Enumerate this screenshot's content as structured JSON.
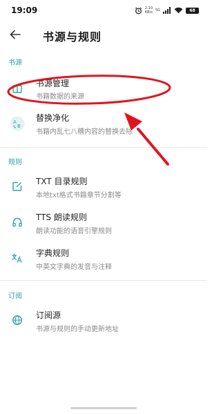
{
  "status_bar": {
    "time": "19:09",
    "net_speed_value": "2.10",
    "net_speed_unit": "KB/s",
    "signal_label": "5G",
    "battery": "68"
  },
  "header": {
    "title": "书源与规则"
  },
  "sections": {
    "source": {
      "header": "书源",
      "items": [
        {
          "title": "书源管理",
          "desc": "书籍数据的来源"
        },
        {
          "title": "替换净化",
          "desc": "书籍内乱七八糟内容的替换去除"
        }
      ]
    },
    "rules": {
      "header": "规则",
      "items": [
        {
          "title": "TXT 目录规则",
          "desc": "本地txt格式书籍章节分割等"
        },
        {
          "title": "TTS 朗读规则",
          "desc": "朗读功能的语音引擎规则"
        },
        {
          "title": "字典规则",
          "desc": "中英文字典的发音与注释"
        }
      ]
    },
    "subscribe": {
      "header": "订阅",
      "items": [
        {
          "title": "订阅源",
          "desc": "书源与规则的手动更新地址"
        }
      ]
    }
  },
  "icons": {
    "back": "arrow-left-icon",
    "book_source": "book-icon",
    "replace": "replace-ab-icon",
    "txt_toc": "edit-icon",
    "tts": "headphones-icon",
    "dictionary": "translate-icon",
    "subscribe": "globe-icon"
  },
  "colors": {
    "accent": "#2aa59b",
    "annotation": "#e0141e"
  }
}
